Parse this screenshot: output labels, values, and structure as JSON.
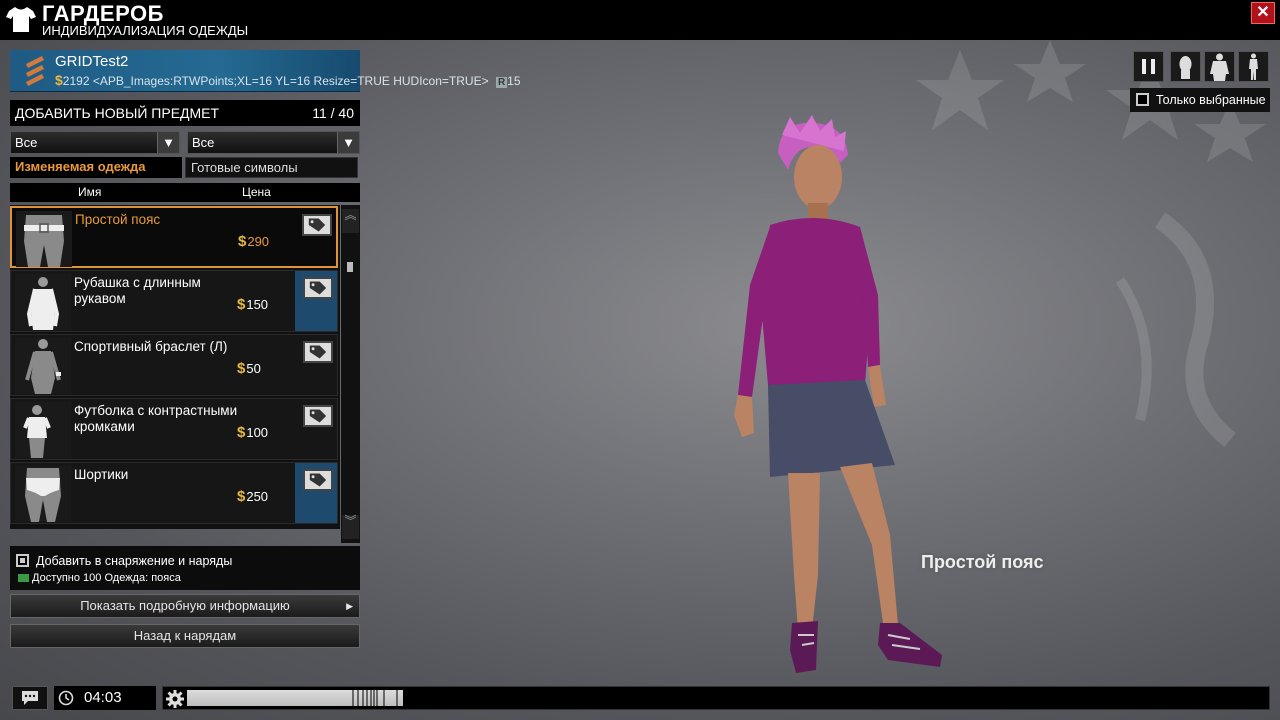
{
  "header": {
    "title": "ГАРДЕРОБ",
    "subtitle": "ИНДИВИДУАЛИЗАЦИЯ ОДЕЖДЫ",
    "close_label": "✕"
  },
  "player": {
    "name": "GRIDTest2",
    "currency_symbol": "$",
    "money": "2192",
    "meta_text": "<APB_Images:RTWPoints;XL=16 YL=16 Resize=TRUE HUDIcon=TRUE>",
    "r_badge": "R",
    "r_value": "15"
  },
  "add_panel": {
    "title": "ДОБАВИТЬ НОВЫЙ ПРЕДМЕТ",
    "count": "11 / 40",
    "filter1": "Все",
    "filter2": "Все",
    "tab_active": "Изменяемая одежда",
    "tab_inactive": "Готовые символы",
    "col_name": "Имя",
    "col_price": "Цена"
  },
  "items": [
    {
      "name": "Простой пояс",
      "price": "290",
      "selected": true
    },
    {
      "name": "Рубашка с длинным рукавом",
      "price": "150"
    },
    {
      "name": "Спортивный браслет (Л)",
      "price": "50"
    },
    {
      "name": "Футболка с контрастными кромками",
      "price": "100"
    },
    {
      "name": "Шортики",
      "price": "250"
    }
  ],
  "info": {
    "add_to_outfit": "Добавить в снаряжение и наряды",
    "available": "Доступно 100 Одежда: пояса"
  },
  "buttons": {
    "details": "Показать подробную информацию",
    "details_arrow": "▶",
    "back": "Назад к нарядам"
  },
  "view": {
    "only_selected": "Только выбранные"
  },
  "preview_label": "Простой пояс",
  "bottom": {
    "time": "04:03",
    "progress": 0.2
  },
  "colors": {
    "accent_orange": "#e89a3c",
    "coin_gold": "#e8b845",
    "selected_blue": "#1d4a6d",
    "close_red": "#b3111a"
  }
}
